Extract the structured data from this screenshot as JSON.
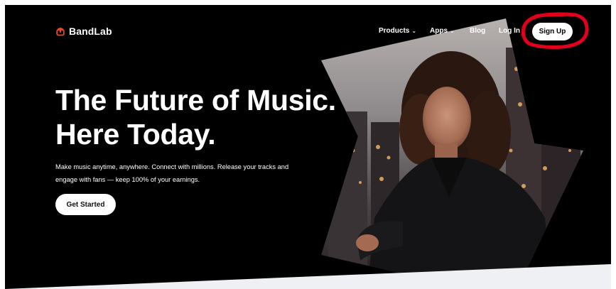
{
  "brand": {
    "name": "BandLab"
  },
  "nav": {
    "items": [
      {
        "label": "Products",
        "has_dropdown": true
      },
      {
        "label": "Apps",
        "has_dropdown": true
      },
      {
        "label": "Blog",
        "has_dropdown": false
      },
      {
        "label": "Log In",
        "has_dropdown": false
      }
    ],
    "dropdown_glyph": "⌄",
    "signup_label": "Sign Up"
  },
  "hero": {
    "title_line1": "The Future of Music.",
    "title_line2": "Here Today.",
    "description": "Make music anytime, anywhere. Connect with millions. Release your tracks and engage with fans — keep 100% of your earnings.",
    "cta_label": "Get Started"
  },
  "colors": {
    "background": "#000000",
    "brand_accent": "#f0472a",
    "annotation_ring": "#e0001b",
    "button_bg": "#ffffff"
  },
  "icons": [
    "bandlab-logo-icon",
    "chevron-down-icon"
  ]
}
